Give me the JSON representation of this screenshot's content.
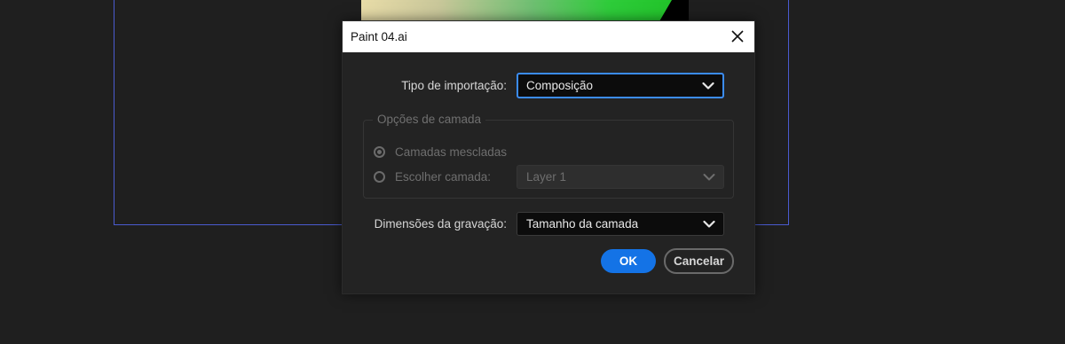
{
  "dialog": {
    "title": "Paint 04.ai"
  },
  "import_type": {
    "label": "Tipo de importação:",
    "value": "Composição"
  },
  "layer_options": {
    "legend": "Opções de camada",
    "merged_label": "Camadas mescladas",
    "choose_label": "Escolher camada:",
    "choose_value": "Layer 1",
    "selected": "merged"
  },
  "footage_dimensions": {
    "label": "Dimensões da gravação:",
    "value": "Tamanho da camada"
  },
  "buttons": {
    "ok": "OK",
    "cancel": "Cancelar"
  },
  "colors": {
    "accent": "#1473e6",
    "focus_ring": "#3b8cf3",
    "background": "#1f1f1f",
    "dialog_bg": "#232323",
    "composition_frame": "#4a5bd0"
  },
  "icons": {
    "close": "close-icon",
    "dropdown": "chevron-down-icon",
    "radio": "radio-icon"
  }
}
